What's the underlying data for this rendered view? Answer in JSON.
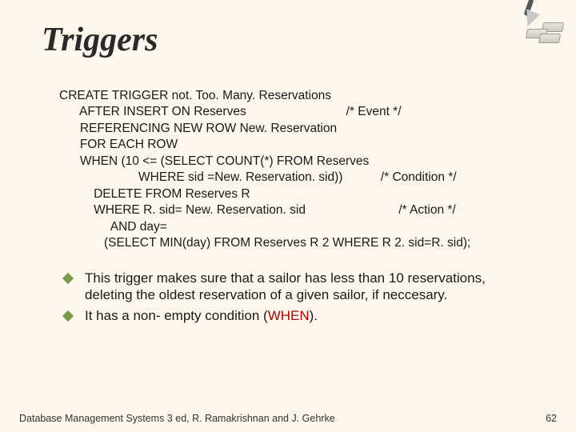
{
  "title": "Triggers",
  "code": {
    "l1a": "CREATE TRIGGER ",
    "l1b": "not. Too. Many. Reservations",
    "l2": "      AFTER INSERT ON Reserves                             /* Event */",
    "l3": "      REFERENCING NEW ROW New. Reservation",
    "l4": "      FOR EACH ROW",
    "l5": "      WHEN (10 <= (SELECT COUNT(*) FROM Reserves",
    "l6": "                       WHERE sid =New. Reservation. sid))           /* Condition */",
    "l7": "          DELETE FROM Reserves R",
    "l8": "          WHERE R. sid= New. Reservation. sid                           /* Action */",
    "l9": "               AND day=",
    "l10": "             (SELECT MIN(day) FROM Reserves R 2 WHERE R 2. sid=R. sid);"
  },
  "notes": {
    "n1a": "This trigger makes sure that a sailor has less than 10 reservations, deleting the oldest reservation of a given sailor, if neccesary.",
    "n2a": "It has a non- empty condition (",
    "n2b": "WHEN",
    "n2c": ")."
  },
  "footer": {
    "left": "Database Management Systems 3 ed, R. Ramakrishnan and J. Gehrke",
    "right": "62"
  }
}
